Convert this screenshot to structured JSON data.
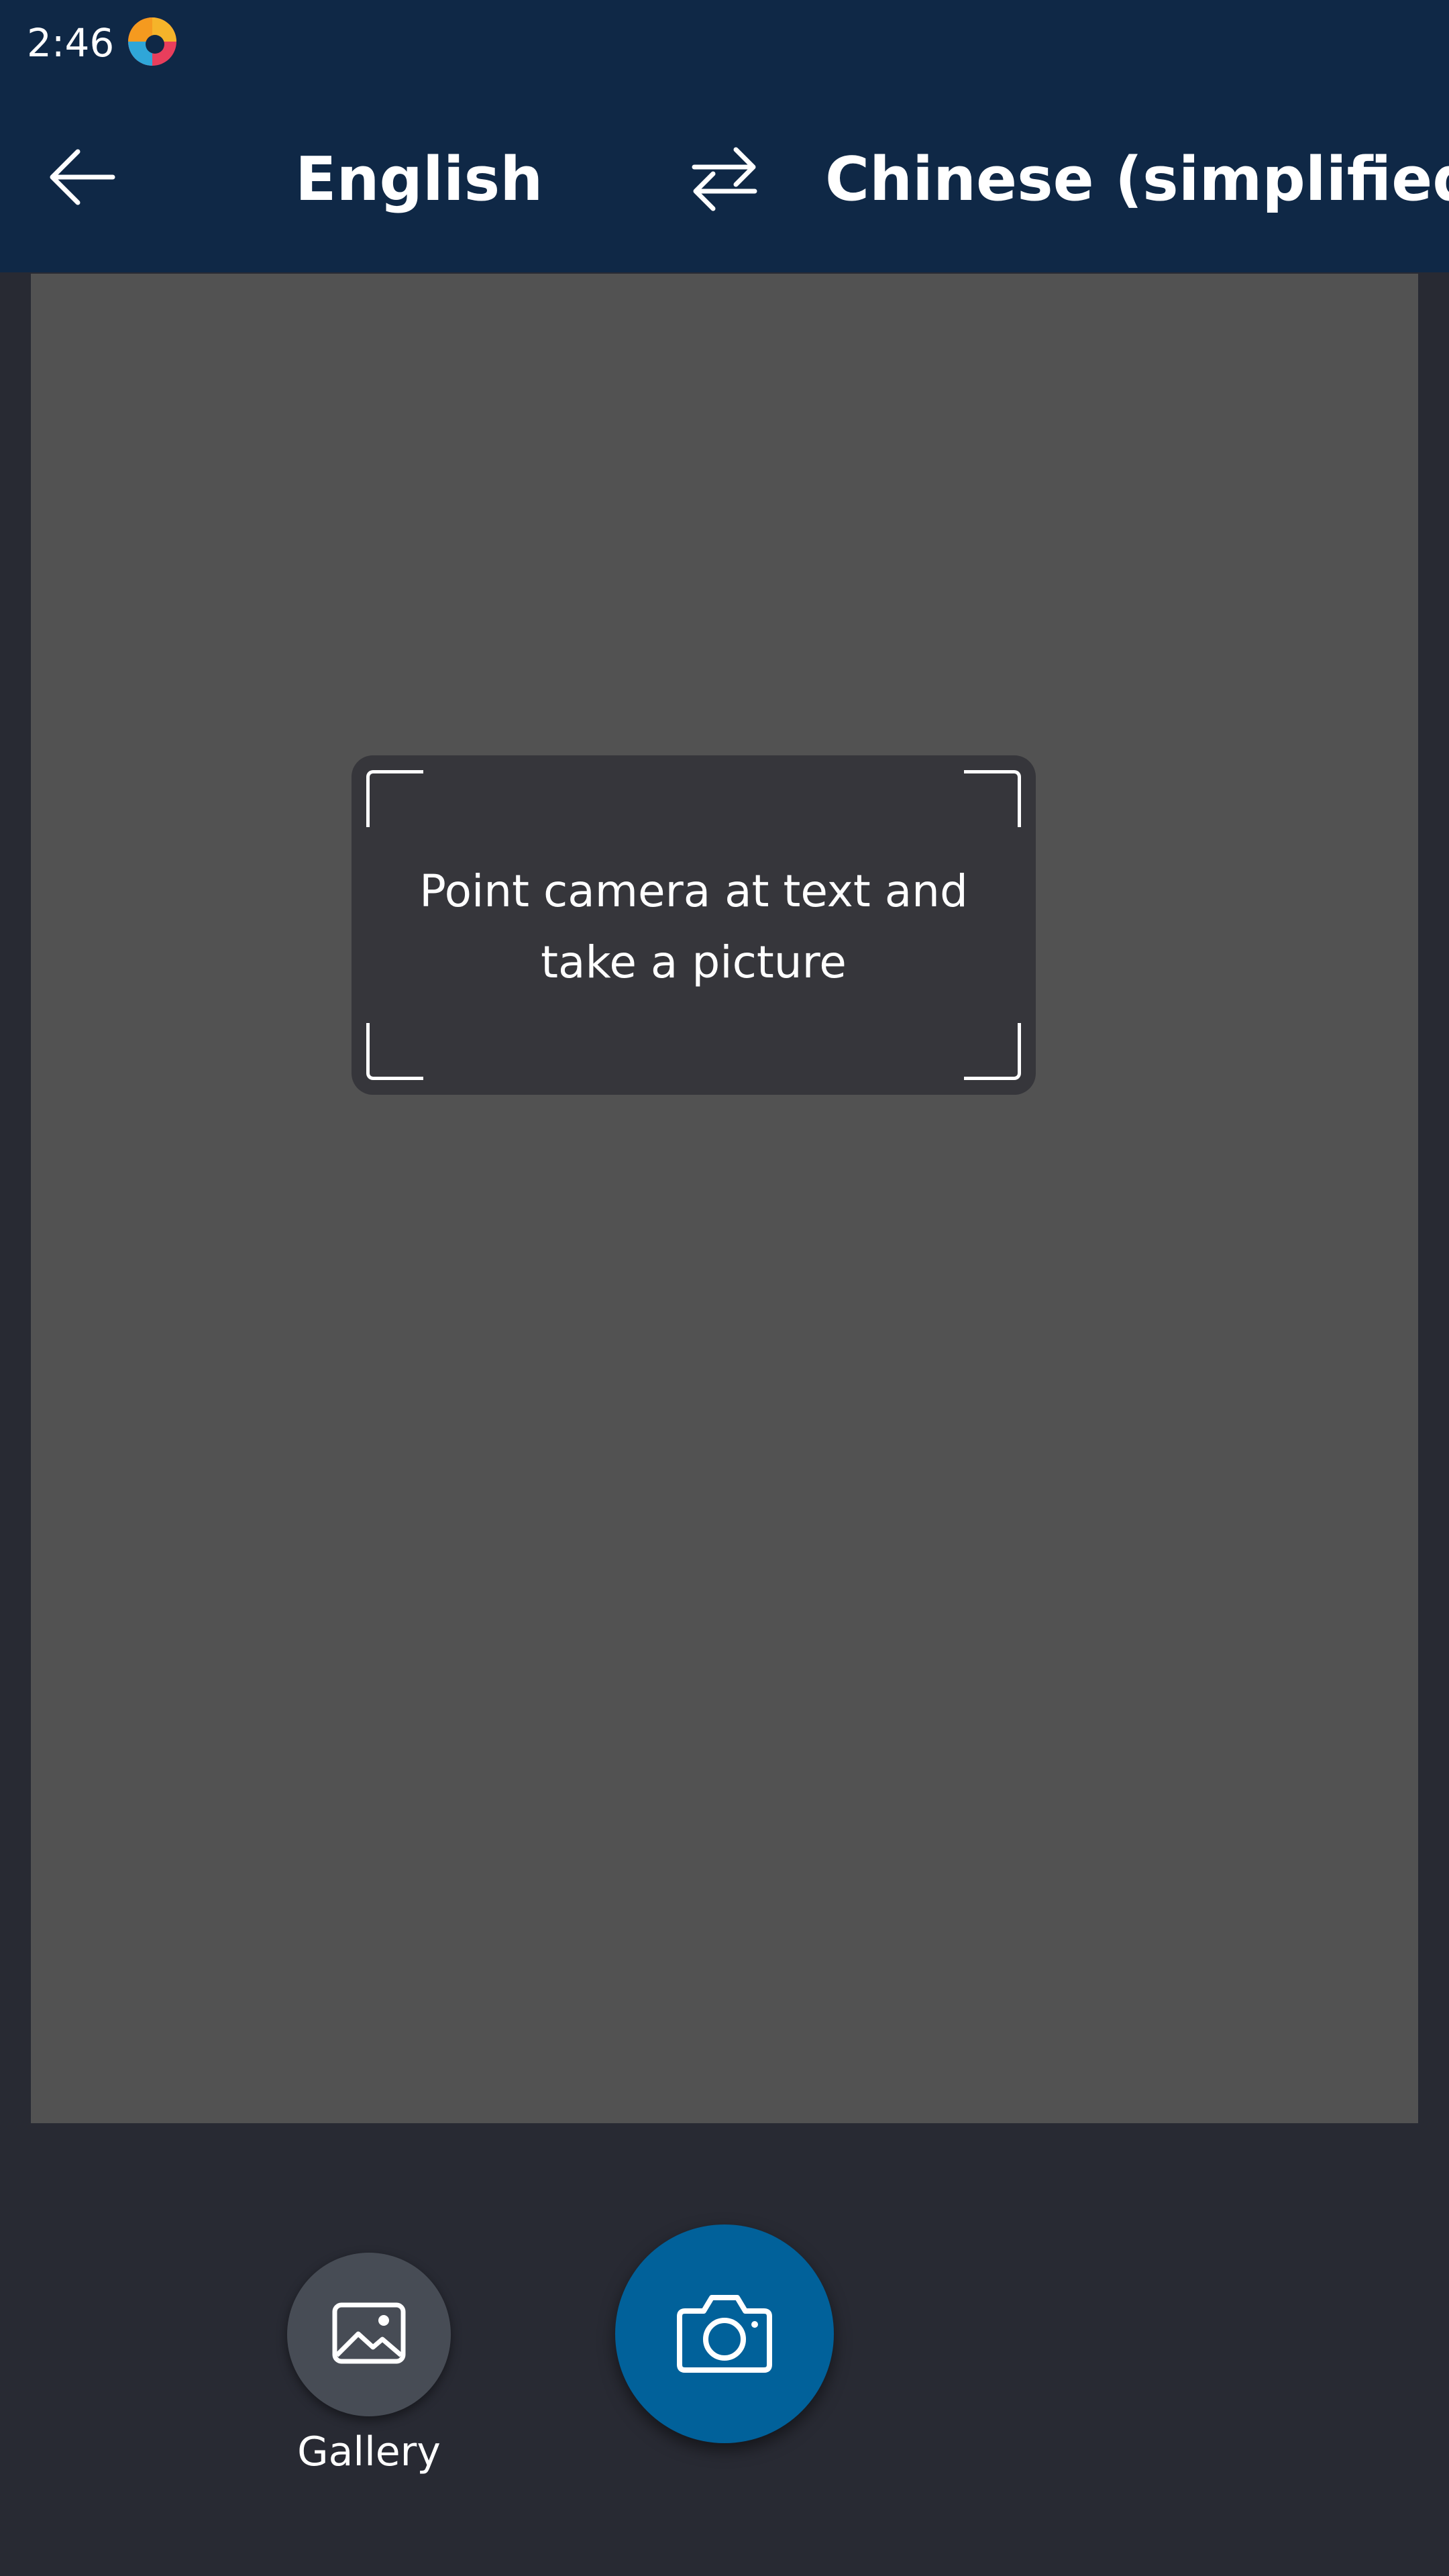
{
  "status_bar": {
    "time": "2:46",
    "app_icon": "app-logo-icon"
  },
  "header": {
    "back_icon": "arrow-left-icon",
    "source_language": "English",
    "swap_icon": "swap-arrows-icon",
    "target_language": "Chinese (simplified)"
  },
  "viewfinder": {
    "hint": "Point camera at text and take a picture"
  },
  "controls": {
    "gallery_label": "Gallery",
    "gallery_icon": "image-icon",
    "capture_icon": "camera-icon"
  },
  "colors": {
    "header_bg": "#0f2846",
    "viewfinder_bg": "#525252",
    "hint_bg": "#36363b",
    "footer_bg": "#282a33",
    "capture_accent": "#01619a",
    "gallery_bg": "#474c55"
  }
}
